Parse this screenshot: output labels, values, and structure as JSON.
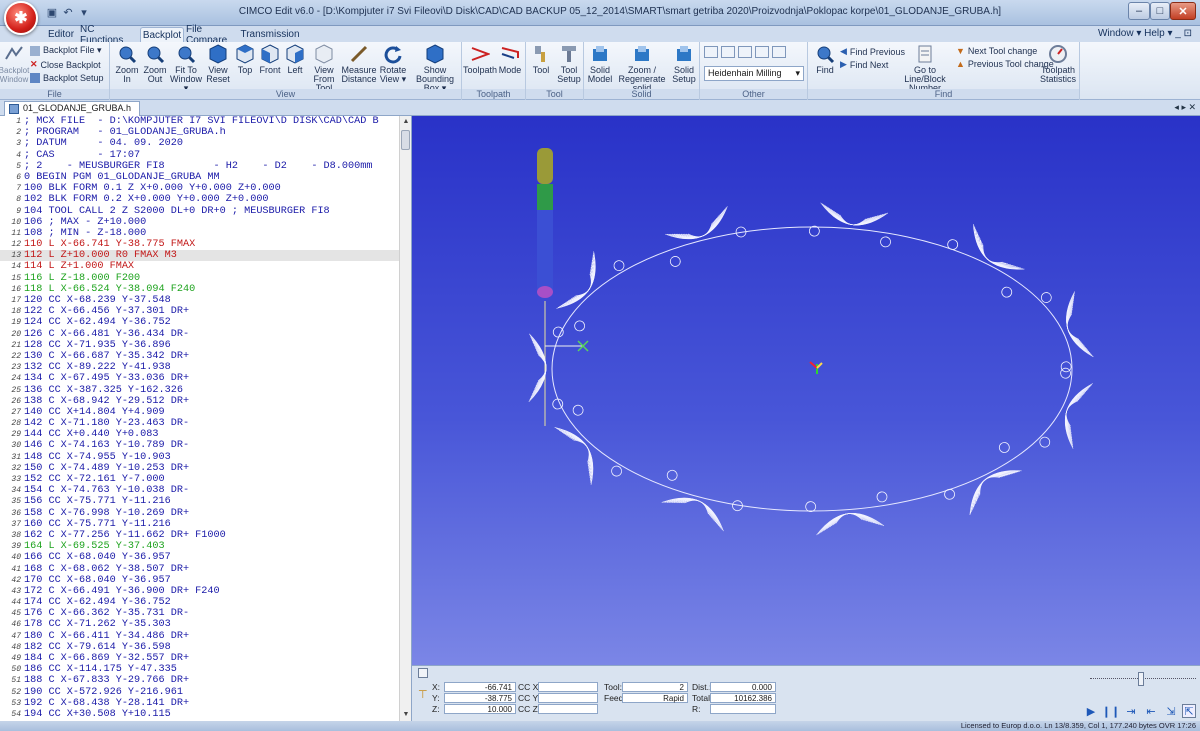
{
  "window": {
    "title": "CIMCO Edit v6.0 - [D:\\Kompjuter i7 Svi Fileovi\\D Disk\\CAD\\CAD BACKUP 05_12_2014\\SMART\\smart getriba 2020\\Proizvodnja\\Poklopac korpe\\01_GLODANJE_GRUBA.h]",
    "minimize": "–",
    "maximize": "□",
    "close": "✕"
  },
  "menu": {
    "tabs": [
      "Editor",
      "NC Functions",
      "Backplot",
      "File Compare",
      "Transmission"
    ],
    "active": "Backplot",
    "right": "Window ▾  Help ▾  _  ⊡"
  },
  "ribbon": {
    "file_group": {
      "label": "File",
      "backplot_window": "Backplot Window",
      "backplot_file": "Backplot File ▾",
      "close_backplot": "Close Backplot",
      "backplot_setup": "Backplot Setup"
    },
    "view_group": {
      "label": "View",
      "buttons": [
        "Zoom In",
        "Zoom Out",
        "Fit To Window ▾",
        "View Reset",
        "Top",
        "Front",
        "Left",
        "View From Tool",
        "Measure Distance",
        "Rotate View ▾",
        "Show Bounding Box ▾"
      ]
    },
    "toolpath_group": {
      "label": "Toolpath",
      "buttons": [
        "Toolpath",
        "Mode"
      ]
    },
    "tool_group": {
      "label": "Tool",
      "buttons": [
        "Tool",
        "Tool Setup"
      ]
    },
    "solid_group": {
      "label": "Solid",
      "buttons": [
        "Solid Model",
        "Zoom / Regenerate solid",
        "Solid Setup"
      ]
    },
    "other_group": {
      "label": "Other",
      "machine": "Heidenhain Milling"
    },
    "find_group": {
      "label": "Find",
      "find": "Find",
      "find_previous": "Find Previous",
      "find_next": "Find Next",
      "goto": "Go to Line/Block Number",
      "next_tool_change": "Next Tool change",
      "previous_tool_change": "Previous Tool change",
      "toolpath_statistics": "Toolpath Statistics"
    }
  },
  "document_tab": "01_GLODANJE_GRUBA.h",
  "document_nav": "◂ ▸ ✕",
  "code_lines": [
    {
      "n": "1",
      "t": "; MCX FILE  - D:\\KOMPJUTER I7 SVI FILEOVI\\D DISK\\CAD\\CAD B",
      "c": ""
    },
    {
      "n": "2",
      "t": "; PROGRAM   - 01_GLODANJE_GRUBA.h",
      "c": ""
    },
    {
      "n": "3",
      "t": "; DATUM     - 04. 09. 2020",
      "c": ""
    },
    {
      "n": "4",
      "t": "; CAS       - 17:07",
      "c": ""
    },
    {
      "n": "5",
      "t": "; 2    - MEUSBURGER FI8        - H2    - D2    - D8.000mm",
      "c": ""
    },
    {
      "n": "6",
      "t": "0 BEGIN PGM 01_GLODANJE_GRUBA MM",
      "c": ""
    },
    {
      "n": "7",
      "t": "100 BLK FORM 0.1 Z X+0.000 Y+0.000 Z+0.000",
      "c": ""
    },
    {
      "n": "8",
      "t": "102 BLK FORM 0.2 X+0.000 Y+0.000 Z+0.000",
      "c": ""
    },
    {
      "n": "9",
      "t": "104 TOOL CALL 2 Z S2000 DL+0 DR+0 ; MEUSBURGER FI8",
      "c": ""
    },
    {
      "n": "10",
      "t": "106 ; MAX - Z+10.000",
      "c": ""
    },
    {
      "n": "11",
      "t": "108 ; MIN - Z-18.000",
      "c": ""
    },
    {
      "n": "12",
      "t": "110 L X-66.741 Y-38.775 FMAX",
      "c": "red"
    },
    {
      "n": "13",
      "t": "112 L Z+10.000 R0 FMAX M3",
      "c": "red cur"
    },
    {
      "n": "14",
      "t": "114 L Z+1.000 FMAX",
      "c": "red"
    },
    {
      "n": "15",
      "t": "116 L Z-18.000 F200",
      "c": "green"
    },
    {
      "n": "16",
      "t": "118 L X-66.524 Y-38.094 F240",
      "c": "green"
    },
    {
      "n": "17",
      "t": "120 CC X-68.239 Y-37.548",
      "c": ""
    },
    {
      "n": "18",
      "t": "122 C X-66.456 Y-37.301 DR+",
      "c": ""
    },
    {
      "n": "19",
      "t": "124 CC X-62.494 Y-36.752",
      "c": ""
    },
    {
      "n": "20",
      "t": "126 C X-66.481 Y-36.434 DR-",
      "c": ""
    },
    {
      "n": "21",
      "t": "128 CC X-71.935 Y-36.896",
      "c": ""
    },
    {
      "n": "22",
      "t": "130 C X-66.687 Y-35.342 DR+",
      "c": ""
    },
    {
      "n": "23",
      "t": "132 CC X-89.222 Y-41.938",
      "c": ""
    },
    {
      "n": "24",
      "t": "134 C X-67.495 Y-33.036 DR+",
      "c": ""
    },
    {
      "n": "25",
      "t": "136 CC X-387.325 Y-162.326",
      "c": ""
    },
    {
      "n": "26",
      "t": "138 C X-68.942 Y-29.512 DR+",
      "c": ""
    },
    {
      "n": "27",
      "t": "140 CC X+14.804 Y+4.909",
      "c": ""
    },
    {
      "n": "28",
      "t": "142 C X-71.180 Y-23.463 DR-",
      "c": ""
    },
    {
      "n": "29",
      "t": "144 CC X+0.440 Y+0.083",
      "c": ""
    },
    {
      "n": "30",
      "t": "146 C X-74.163 Y-10.789 DR-",
      "c": ""
    },
    {
      "n": "31",
      "t": "148 CC X-74.955 Y-10.903",
      "c": ""
    },
    {
      "n": "32",
      "t": "150 C X-74.489 Y-10.253 DR+",
      "c": ""
    },
    {
      "n": "33",
      "t": "152 CC X-72.161 Y-7.000",
      "c": ""
    },
    {
      "n": "34",
      "t": "154 C X-74.763 Y-10.038 DR-",
      "c": ""
    },
    {
      "n": "35",
      "t": "156 CC X-75.771 Y-11.216",
      "c": ""
    },
    {
      "n": "36",
      "t": "158 C X-76.998 Y-10.269 DR+",
      "c": ""
    },
    {
      "n": "37",
      "t": "160 CC X-75.771 Y-11.216",
      "c": ""
    },
    {
      "n": "38",
      "t": "162 C X-77.256 Y-11.662 DR+ F1000",
      "c": ""
    },
    {
      "n": "39",
      "t": "164 L X-69.525 Y-37.403",
      "c": "green"
    },
    {
      "n": "40",
      "t": "166 CC X-68.040 Y-36.957",
      "c": ""
    },
    {
      "n": "41",
      "t": "168 C X-68.062 Y-38.507 DR+",
      "c": ""
    },
    {
      "n": "42",
      "t": "170 CC X-68.040 Y-36.957",
      "c": ""
    },
    {
      "n": "43",
      "t": "172 C X-66.491 Y-36.900 DR+ F240",
      "c": ""
    },
    {
      "n": "44",
      "t": "174 CC X-62.494 Y-36.752",
      "c": ""
    },
    {
      "n": "45",
      "t": "176 C X-66.362 Y-35.731 DR-",
      "c": ""
    },
    {
      "n": "46",
      "t": "178 CC X-71.262 Y-35.303",
      "c": ""
    },
    {
      "n": "47",
      "t": "180 C X-66.411 Y-34.486 DR+",
      "c": ""
    },
    {
      "n": "48",
      "t": "182 CC X-79.614 Y-36.598",
      "c": ""
    },
    {
      "n": "49",
      "t": "184 C X-66.869 Y-32.557 DR+",
      "c": ""
    },
    {
      "n": "50",
      "t": "186 CC X-114.175 Y-47.335",
      "c": ""
    },
    {
      "n": "51",
      "t": "188 C X-67.833 Y-29.766 DR+",
      "c": ""
    },
    {
      "n": "52",
      "t": "190 CC X-572.926 Y-216.961",
      "c": ""
    },
    {
      "n": "53",
      "t": "192 C X-68.438 Y-28.141 DR+",
      "c": ""
    },
    {
      "n": "54",
      "t": "194 CC X+30.508 Y+10.115",
      "c": ""
    }
  ],
  "readout": {
    "x_label": "X:",
    "x": "-66.741",
    "y_label": "Y:",
    "y": "-38.775",
    "z_label": "Z:",
    "z": "10.000",
    "ccx_label": "CC X:",
    "ccy_label": "CC Y:",
    "ccz_label": "CC Z:",
    "tool_label": "Tool:",
    "tool": "2",
    "feed_label": "Feed:",
    "feed": "Rapid",
    "dist_label": "Dist.:",
    "dist": "0.000",
    "total_label": "Total:",
    "total": "10162.386",
    "r_label": "R:"
  },
  "status": "Licensed to Europ d.o.o.    Ln 13/8.359, Col 1, 177.240 bytes    OVR  17:26",
  "colors": {
    "background_top": "#2932c8",
    "background_bottom": "#7b86e6",
    "toolpath": "#ffffff",
    "rapid_red": "#c21818",
    "feed_green": "#1ea31e",
    "code_blue": "#1a1aa8"
  }
}
